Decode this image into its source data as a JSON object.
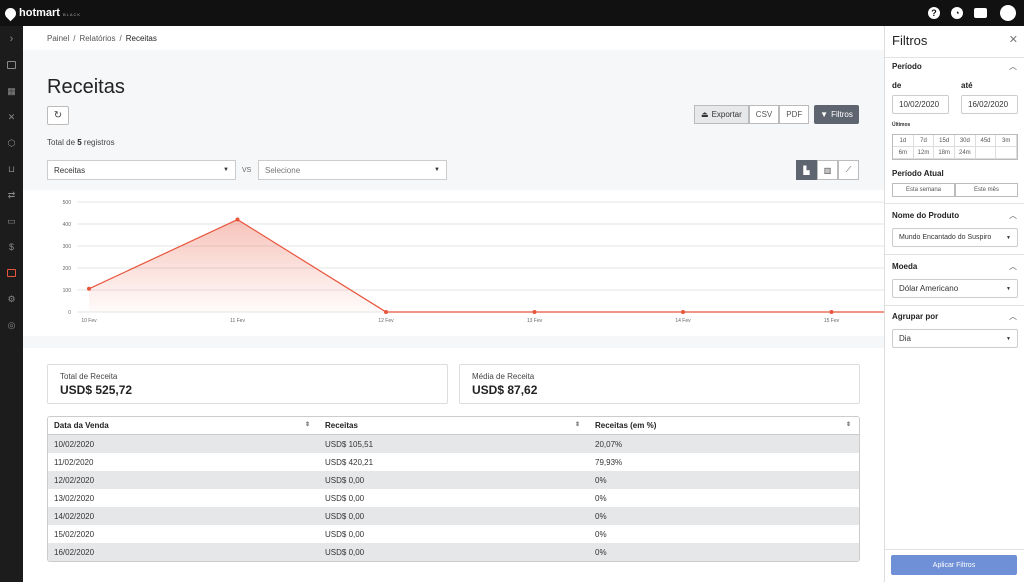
{
  "brand": {
    "name": "hotmart",
    "sub": "BLACK"
  },
  "topbar": {
    "help": "?",
    "icons": [
      "help-icon",
      "gauge-icon",
      "chat-icon",
      "avatar"
    ]
  },
  "breadcrumb": [
    "Painel",
    "Relatórios",
    "Receitas"
  ],
  "page": {
    "title": "Receitas",
    "total_prefix": "Total de ",
    "total_count": "5",
    "total_suffix": " registros"
  },
  "toolbar": {
    "export": "Exportar",
    "csv": "CSV",
    "pdf": "PDF",
    "filters": "Filtros"
  },
  "selects": {
    "left": "Receitas",
    "vs": "VS",
    "right": "Selecione"
  },
  "chart_data": {
    "type": "area",
    "x": [
      "10 Fev",
      "11 Fev",
      "12 Fev",
      "13 Fev",
      "14 Fev",
      "15 Fev",
      "16 Fev"
    ],
    "values": [
      105.51,
      420.21,
      0,
      0,
      0,
      0,
      0
    ],
    "yticks": [
      0,
      100,
      200,
      300,
      400,
      500
    ],
    "ylim": [
      0,
      500
    ],
    "color": "#e8553c",
    "grid": true
  },
  "cards": [
    {
      "label": "Total de Receita",
      "value": "USD$ 525,72"
    },
    {
      "label": "Média de Receita",
      "value": "USD$ 87,62"
    }
  ],
  "table": {
    "headers": [
      "Data da Venda",
      "Receitas",
      "Receitas (em %)"
    ],
    "rows": [
      [
        "10/02/2020",
        "USD$ 105,51",
        "20,07%"
      ],
      [
        "11/02/2020",
        "USD$ 420,21",
        "79,93%"
      ],
      [
        "12/02/2020",
        "USD$ 0,00",
        "0%"
      ],
      [
        "13/02/2020",
        "USD$ 0,00",
        "0%"
      ],
      [
        "14/02/2020",
        "USD$ 0,00",
        "0%"
      ],
      [
        "15/02/2020",
        "USD$ 0,00",
        "0%"
      ],
      [
        "16/02/2020",
        "USD$ 0,00",
        "0%"
      ]
    ]
  },
  "filters": {
    "title": "Filtros",
    "periodo": "Período",
    "de": "de",
    "ate": "até",
    "from": "10/02/2020",
    "to": "16/02/2020",
    "ultimos": "Últimos",
    "ranges": [
      "1d",
      "7d",
      "15d",
      "30d",
      "45d",
      "3m",
      "6m",
      "12m",
      "18m",
      "24m"
    ],
    "periodo_atual": "Período Atual",
    "semana": "Esta semana",
    "mes": "Este mês",
    "produto_label": "Nome do Produto",
    "produto": "Mundo Encantado do Suspiro",
    "moeda_label": "Moeda",
    "moeda": "Dólar Americano",
    "agrupar_label": "Agrupar por",
    "agrupar": "Dia",
    "apply": "Aplicar Filtros"
  }
}
